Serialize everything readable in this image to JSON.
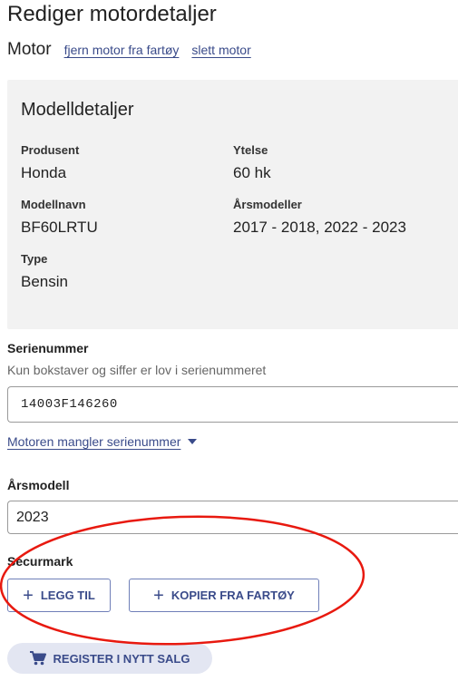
{
  "page": {
    "title": "Rediger motordetaljer"
  },
  "motor": {
    "label": "Motor",
    "remove_link": "fjern motor fra fartøy",
    "delete_link": "slett motor"
  },
  "model_details": {
    "title": "Modelldetaljer",
    "fields": [
      {
        "label": "Produsent",
        "value": "Honda"
      },
      {
        "label": "Ytelse",
        "value": "60 hk"
      },
      {
        "label": "Modellnavn",
        "value": "BF60LRTU"
      },
      {
        "label": "Årsmodeller",
        "value": "2017 - 2018, 2022 - 2023"
      },
      {
        "label": "Type",
        "value": "Bensin"
      }
    ]
  },
  "serial": {
    "label": "Serienummer",
    "help": "Kun bokstaver og siffer er lov i serienummeret",
    "value": "14003F146260",
    "missing_toggle": "Motoren mangler serienummer"
  },
  "year": {
    "label": "Årsmodell",
    "value": "2023"
  },
  "securmark": {
    "label": "Securmark",
    "add_button": "LEGG TIL",
    "copy_button": "KOPIER FRA FARTØY"
  },
  "register_button": "REGISTER I NYTT SALG",
  "colors": {
    "link": "#3a4b8a",
    "card_bg": "#f2f2f2",
    "annotation": "#e8190f",
    "register_bg": "#e3e6f2"
  }
}
